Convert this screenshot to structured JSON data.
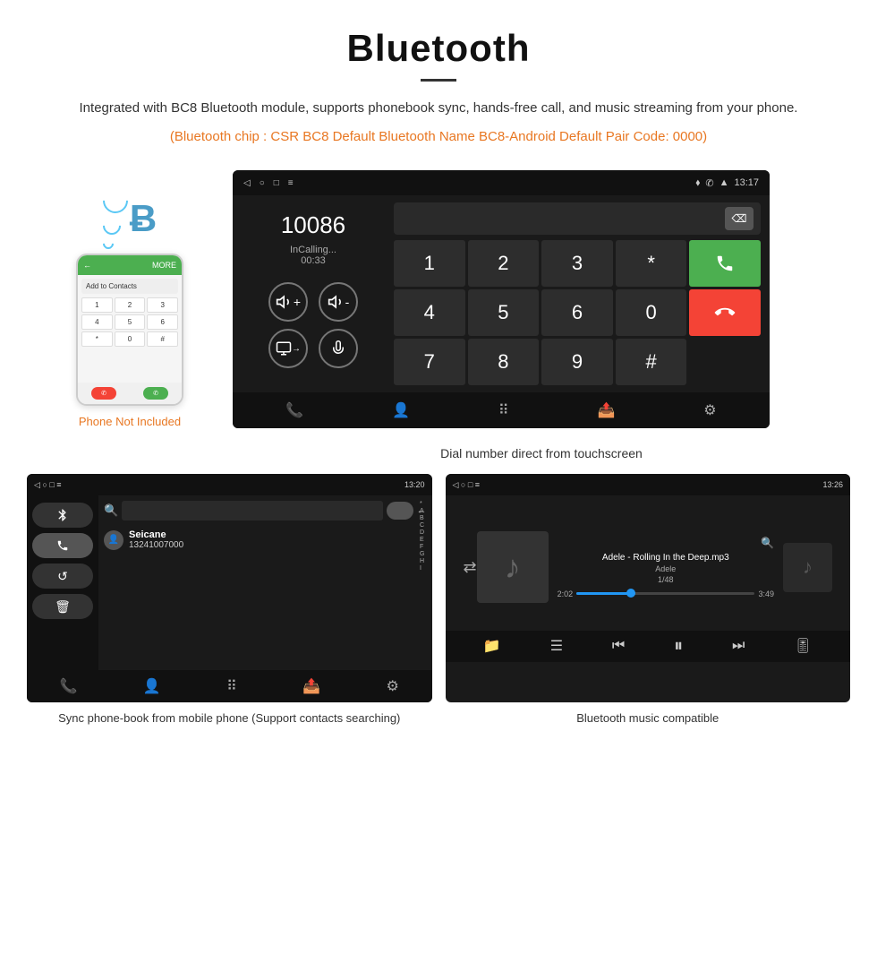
{
  "header": {
    "title": "Bluetooth",
    "description": "Integrated with BC8 Bluetooth module, supports phonebook sync, hands-free call, and music streaming from your phone.",
    "spec": "(Bluetooth chip : CSR BC8    Default Bluetooth Name BC8-Android    Default Pair Code: 0000)"
  },
  "phone": {
    "not_included": "Phone Not Included",
    "contact": "Add to Contacts",
    "keys": [
      "1",
      "2",
      "3",
      "4",
      "5",
      "6",
      "*",
      "0",
      "#"
    ]
  },
  "dial_screen": {
    "status_time": "13:17",
    "status_icons": "♦ ✆ ▲",
    "number": "10086",
    "in_calling": "InCalling...",
    "timer": "00:33",
    "keys": [
      "1",
      "2",
      "3",
      "*",
      "",
      "4",
      "5",
      "6",
      "0",
      "",
      "7",
      "8",
      "9",
      "#",
      ""
    ]
  },
  "dial_caption": "Dial number direct from touchscreen",
  "phonebook_screen": {
    "status_time": "13:20",
    "contact_name": "Seicane",
    "contact_phone": "13241007000",
    "alphabet": [
      "*",
      "A",
      "B",
      "C",
      "D",
      "E",
      "F",
      "G",
      "H",
      "I"
    ],
    "back_arrow": "←"
  },
  "phonebook_caption": "Sync phone-book from mobile phone\n(Support contacts searching)",
  "music_screen": {
    "status_time": "13:26",
    "song_title": "Adele - Rolling In the Deep.mp3",
    "artist": "Adele",
    "track_num": "1/48",
    "time_current": "2:02",
    "time_total": "3:49"
  },
  "music_caption": "Bluetooth music compatible"
}
